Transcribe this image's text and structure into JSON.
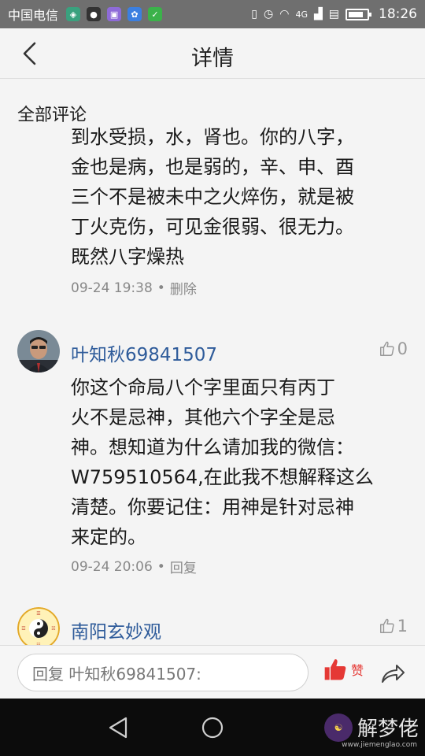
{
  "status_bar": {
    "carrier": "中国电信",
    "network": "4G",
    "time": "18:26",
    "icons": [
      "shield-icon",
      "qq-icon",
      "gallery-icon",
      "baidu-icon",
      "wechat-icon"
    ]
  },
  "header": {
    "title": "详情",
    "back_icon": "chevron-left-icon"
  },
  "section_title": "全部评论",
  "main_comment": {
    "lines": [
      "到水受损，水，肾也。你的八字，",
      "金也是病，也是弱的，辛、申、酉",
      "三个不是被未中之火焠伤，就是被",
      "丁火克伤，可见金很弱、很无力。",
      "既然八字燥热"
    ],
    "time": "09-24 19:38",
    "separator": "•",
    "action": "删除"
  },
  "comments": [
    {
      "author": "叶知秋69841507",
      "likes": "0",
      "lines": [
        "你这个命局八个字里面只有丙丁",
        "火不是忌神，其他六个字全是忌",
        "神。想知道为什么请加我的微信：",
        "W759510564,在此我不想解释这么",
        "清楚。你要记住：用神是针对忌神",
        "来定的。"
      ],
      "time": "09-24 20:06",
      "separator": "•",
      "action": "回复"
    },
    {
      "author": "南阳玄妙观",
      "likes": "1"
    }
  ],
  "input_bar": {
    "placeholder": "回复 叶知秋69841507:",
    "like_label": "赞"
  },
  "watermark": {
    "text": "解梦佬",
    "url": "www.jiemenglao.com"
  },
  "colors": {
    "author": "#2e5b9a",
    "like_active": "#e53935",
    "status_bar": "#6f6f6f"
  }
}
